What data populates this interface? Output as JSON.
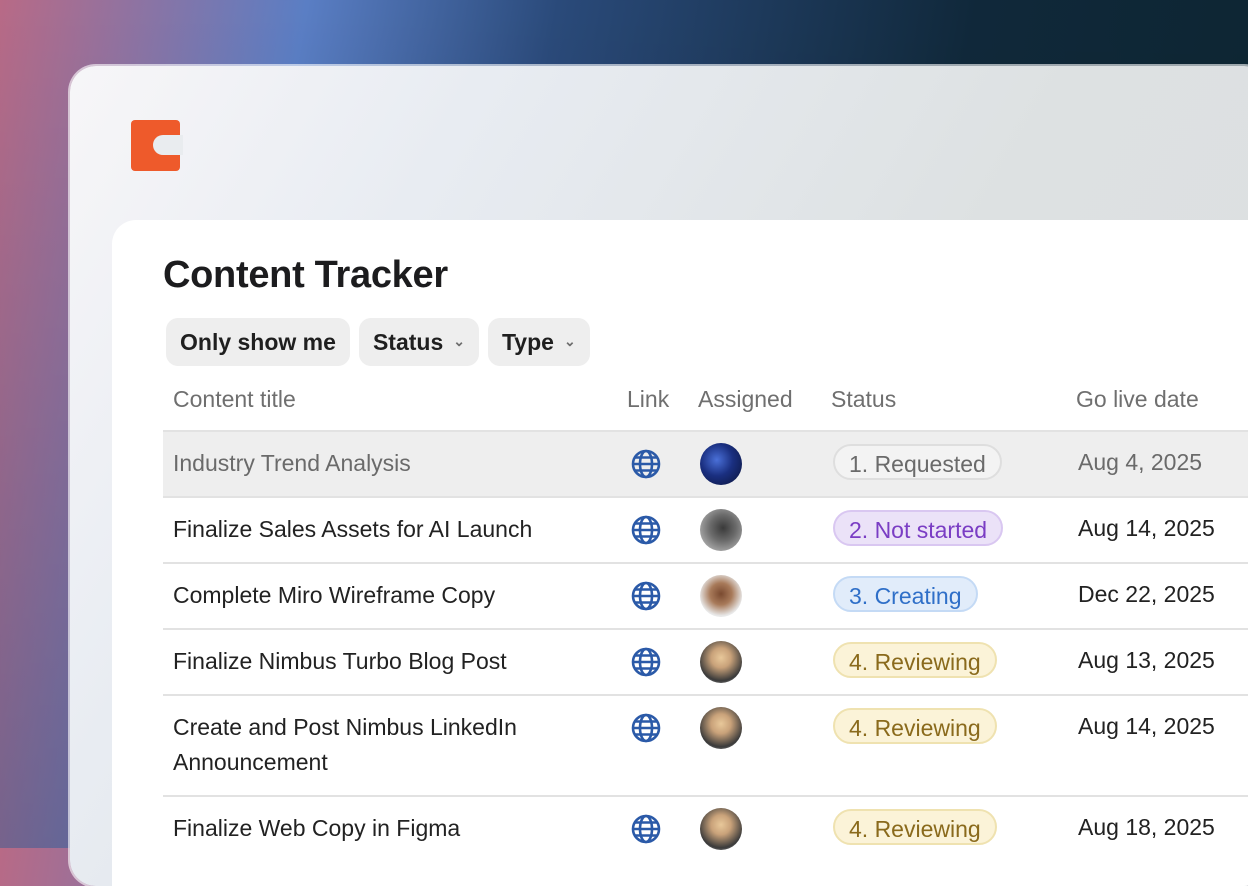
{
  "app": {
    "logo": "coda-logo"
  },
  "page": {
    "title": "Content Tracker"
  },
  "filters": [
    {
      "label": "Only show me",
      "has_dropdown": false
    },
    {
      "label": "Status",
      "has_dropdown": true
    },
    {
      "label": "Type",
      "has_dropdown": true
    }
  ],
  "table": {
    "columns": [
      "Content title",
      "Link",
      "Assigned",
      "Status",
      "Go live date"
    ],
    "rows": [
      {
        "title": "Industry Trend Analysis",
        "link_icon": "globe-icon",
        "status": "1. Requested",
        "date": "Aug 4, 2025"
      },
      {
        "title": "Finalize Sales Assets for AI Launch",
        "link_icon": "globe-icon",
        "status": "2. Not started",
        "date": "Aug 14, 2025"
      },
      {
        "title": "Complete Miro Wireframe Copy",
        "link_icon": "globe-icon",
        "status": "3. Creating",
        "date": "Dec 22, 2025"
      },
      {
        "title": "Finalize Nimbus Turbo Blog Post",
        "link_icon": "globe-icon",
        "status": "4. Reviewing",
        "date": "Aug 13, 2025"
      },
      {
        "title": "Create and Post Nimbus LinkedIn Announcement",
        "link_icon": "globe-icon",
        "status": "4. Reviewing",
        "date": "Aug 14, 2025"
      },
      {
        "title": "Finalize Web Copy in Figma",
        "link_icon": "globe-icon",
        "status": "4. Reviewing",
        "date": "Aug 18, 2025"
      }
    ]
  },
  "colors": {
    "logo": "#ee5a2b",
    "globe": "#2b5aa8",
    "status_requested": "#6a6a6a",
    "status_not_started": "#7a3dc4",
    "status_creating": "#2f6fc8",
    "status_reviewing": "#8a6a1c"
  }
}
